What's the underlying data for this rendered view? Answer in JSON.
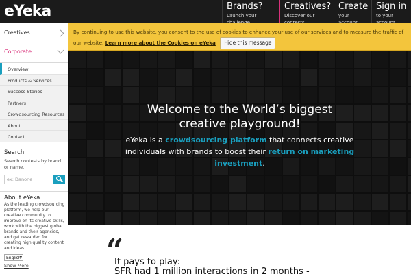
{
  "header": {
    "logo": "eYeka",
    "nav": [
      {
        "title": "Brands?",
        "subtitle": "Launch your challenge"
      },
      {
        "title": "Creatives?",
        "subtitle": "Discover our contests"
      },
      {
        "title": "Create",
        "subtitle": "your account"
      },
      {
        "title": "Sign in",
        "subtitle": "to your account"
      }
    ]
  },
  "sidebar": {
    "sections": [
      {
        "label": "Creatives",
        "state": "collapsed"
      },
      {
        "label": "Corporate",
        "state": "expanded"
      }
    ],
    "corporate_items": [
      {
        "label": "Overview",
        "active": true
      },
      {
        "label": "Products & Services"
      },
      {
        "label": "Success Stories"
      },
      {
        "label": "Partners"
      },
      {
        "label": "Crowdsourcing Resources"
      },
      {
        "label": "About"
      },
      {
        "label": "Contact"
      }
    ],
    "search": {
      "title": "Search",
      "description": "Search contests by brand or name.",
      "placeholder": "ex: Danone"
    },
    "about": {
      "title": "About eYeka",
      "text": "As the leading crowdsourcing platform, we help our creative community to improve on its creative skills, work with the biggest global brands and their agencies, and get rewarded for creating high quality content and ideas."
    },
    "language": "English",
    "show_more": "Show More"
  },
  "cookie_banner": {
    "text": "By continuing to use this website, you consent to the use of cookies to enhance your use of our services and to measure the traffic of our website.",
    "link": "Learn more about the Cookies on eYeka",
    "button": "Hide this message"
  },
  "hero": {
    "title_line1": "Welcome to the World’s biggest",
    "title_line2": "creative playground!",
    "sub_part1": "eYeka is a ",
    "sub_highlight1": "crowdsourcing platform",
    "sub_part2": " that connects creative individuals with brands to boost their ",
    "sub_highlight2": "return on marketing investment",
    "sub_part3": "."
  },
  "quote": {
    "mark": "“",
    "line1": "It pays to play:",
    "line2": "SFR had 1 million interactions in 2 months -"
  },
  "colors": {
    "accent_blue": "#1a9fbe",
    "accent_pink": "#d8317a",
    "cookie_yellow": "#f3c53c",
    "header_dark": "#1b1b1b"
  }
}
